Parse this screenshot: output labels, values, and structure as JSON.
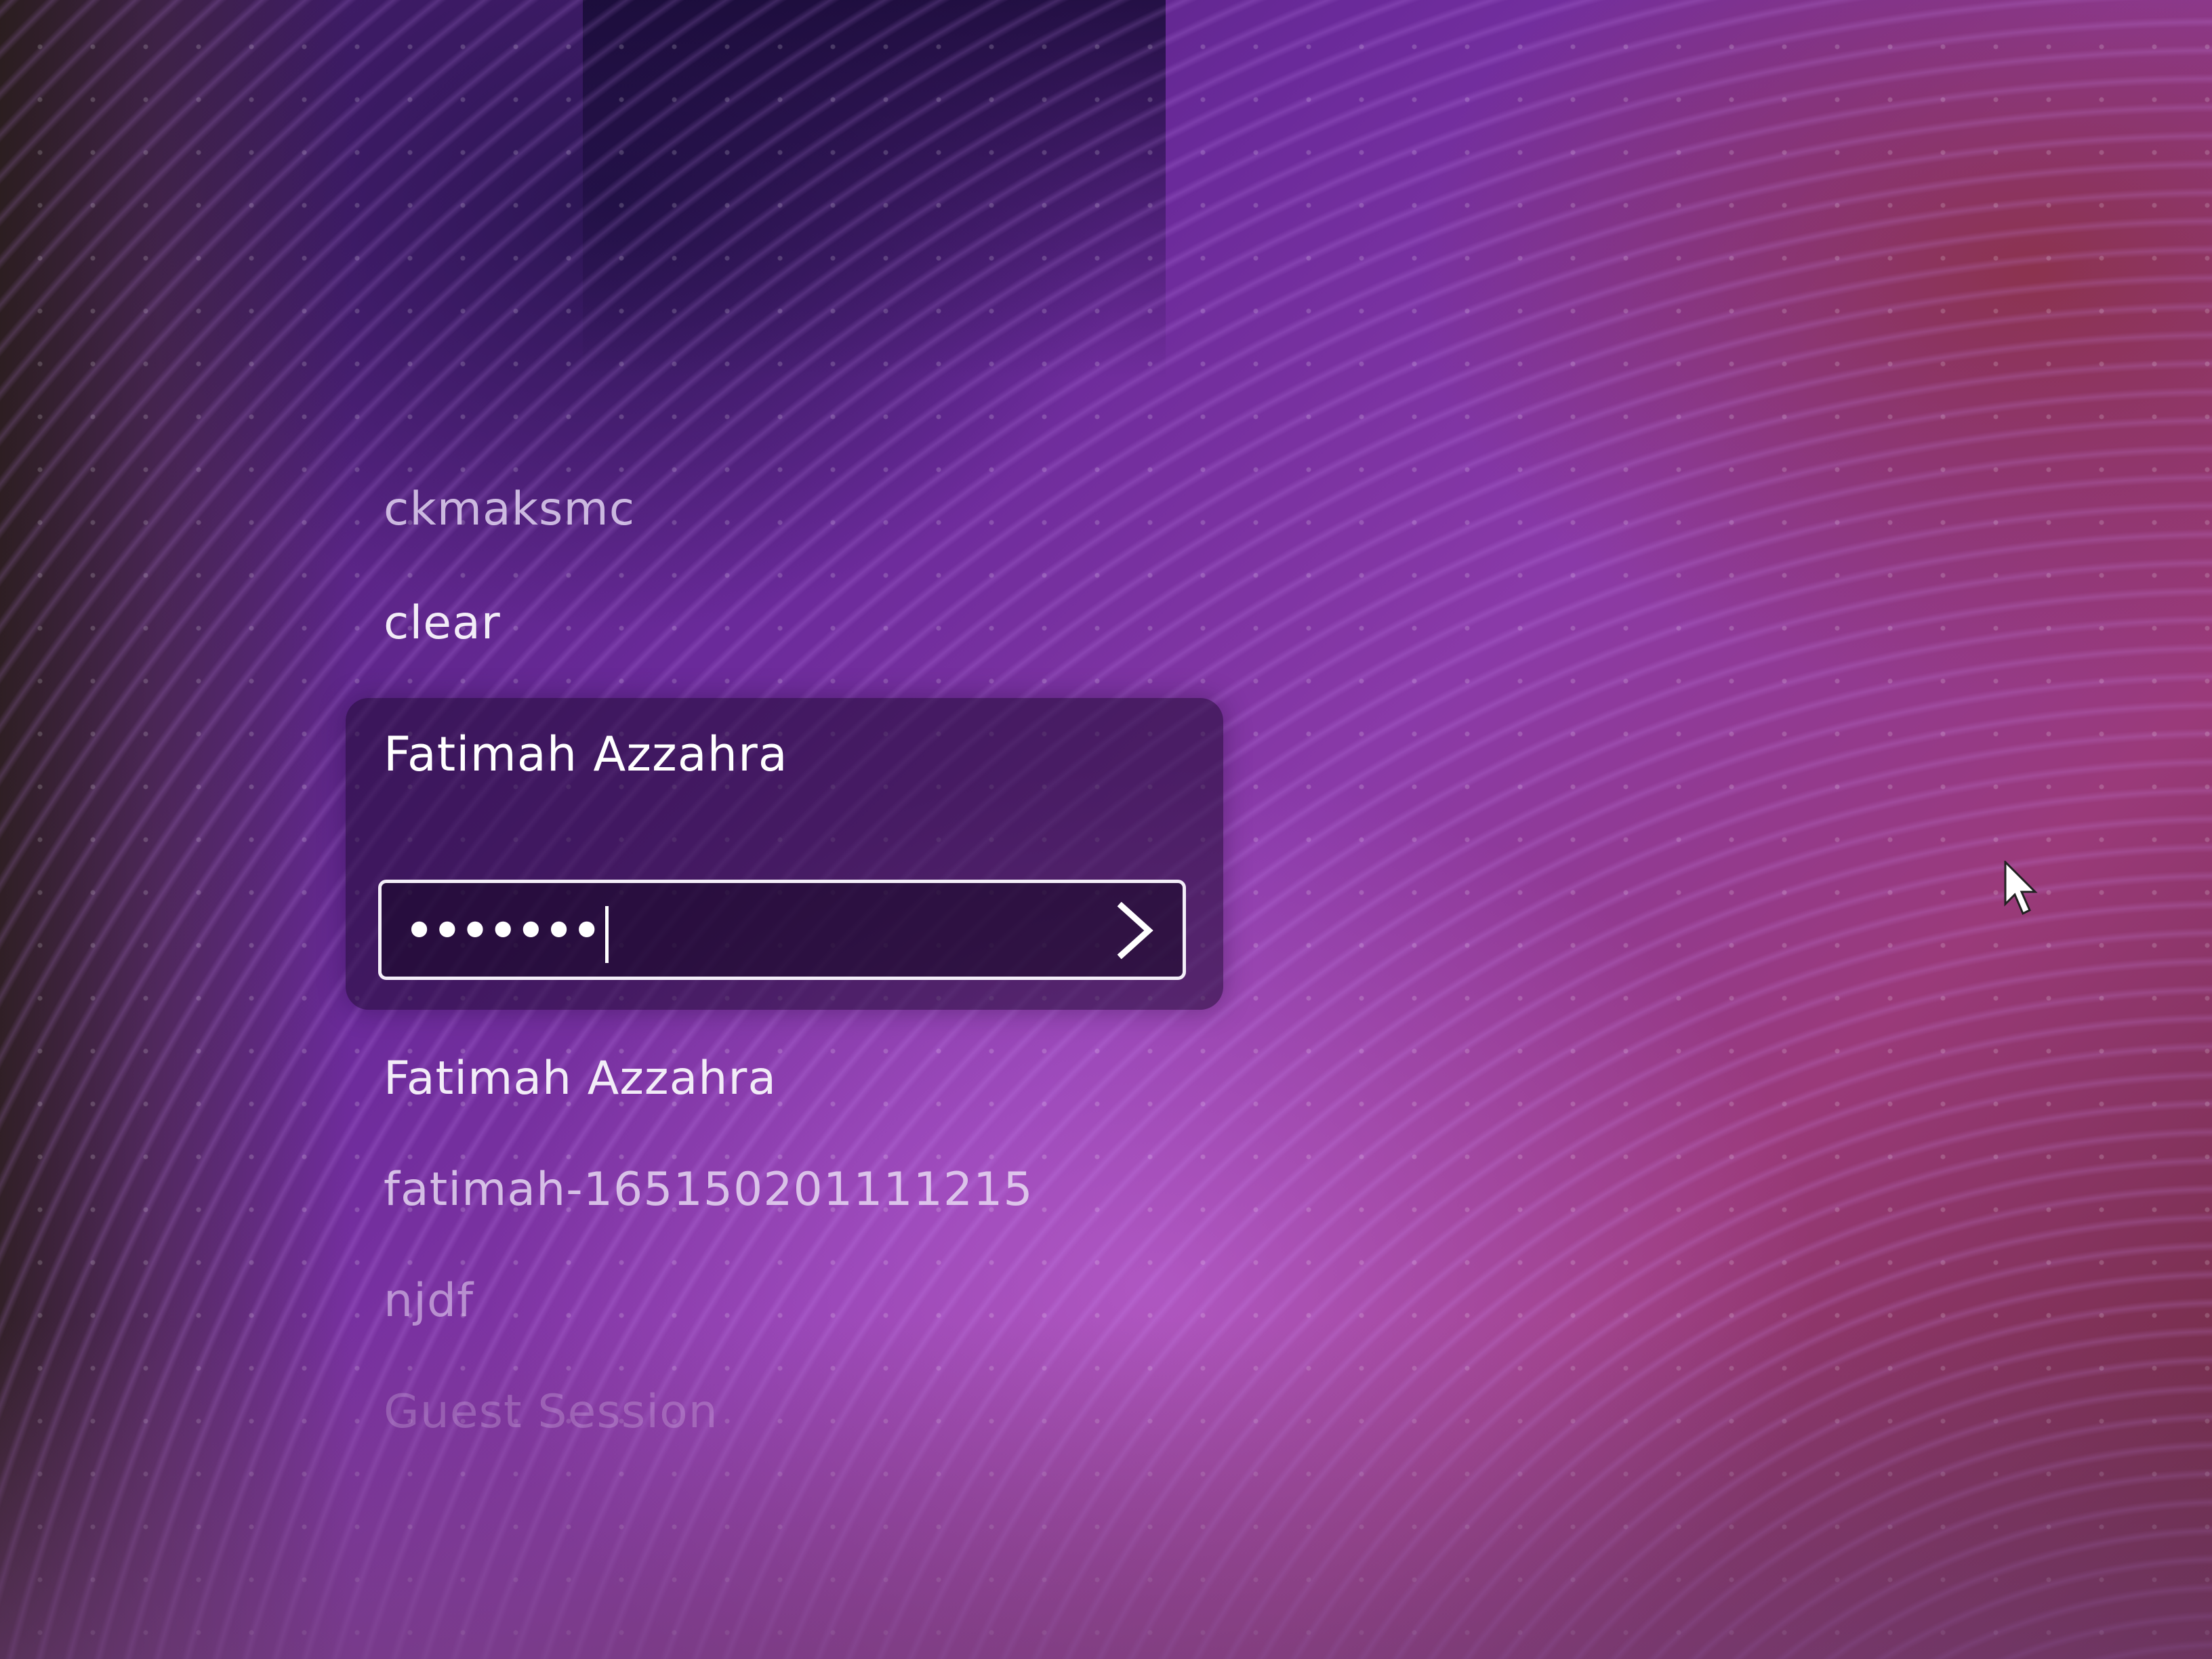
{
  "user_list": {
    "above": [
      {
        "label": "ckmaksmc"
      },
      {
        "label": "clear"
      }
    ],
    "selected": {
      "name": "Fatimah Azzahra",
      "password_masked": "•••••••"
    },
    "below": [
      {
        "label": "Fatimah Azzahra"
      },
      {
        "label": "fatimah-165150201111215"
      },
      {
        "label": "njdf"
      },
      {
        "label": "Guest Session"
      }
    ]
  },
  "icons": {
    "submit": "chevron-right-icon",
    "pointer": "mouse-pointer-icon"
  },
  "colors": {
    "text": "#f2ecf7",
    "card_bg": "rgba(30,10,50,0.55)",
    "field_border": "#f3eef8"
  }
}
